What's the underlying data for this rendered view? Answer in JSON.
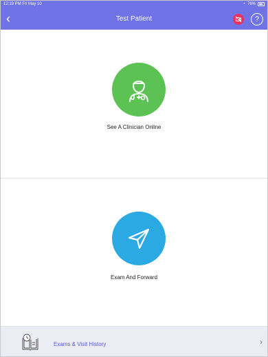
{
  "status": {
    "time": "12:19 PM  Fri May 10",
    "battery": "76%"
  },
  "nav": {
    "title": "Test Patient",
    "back_icon": "chevron-left-icon",
    "mute_icon": "video-off-icon",
    "help_glyph": "?"
  },
  "actions": [
    {
      "label": "See A Clinician Online",
      "icon": "doctor-icon",
      "color": "#5cc254"
    },
    {
      "label": "Exam And Forward",
      "icon": "send-icon",
      "color": "#2aa9e2"
    }
  ],
  "history": {
    "label": "Exams & Visit History",
    "icon": "book-clock-icon"
  },
  "colors": {
    "accent": "#7073e6",
    "mute": "#e9345f",
    "history_bg": "#ececf4",
    "history_text": "#5a5adb"
  }
}
